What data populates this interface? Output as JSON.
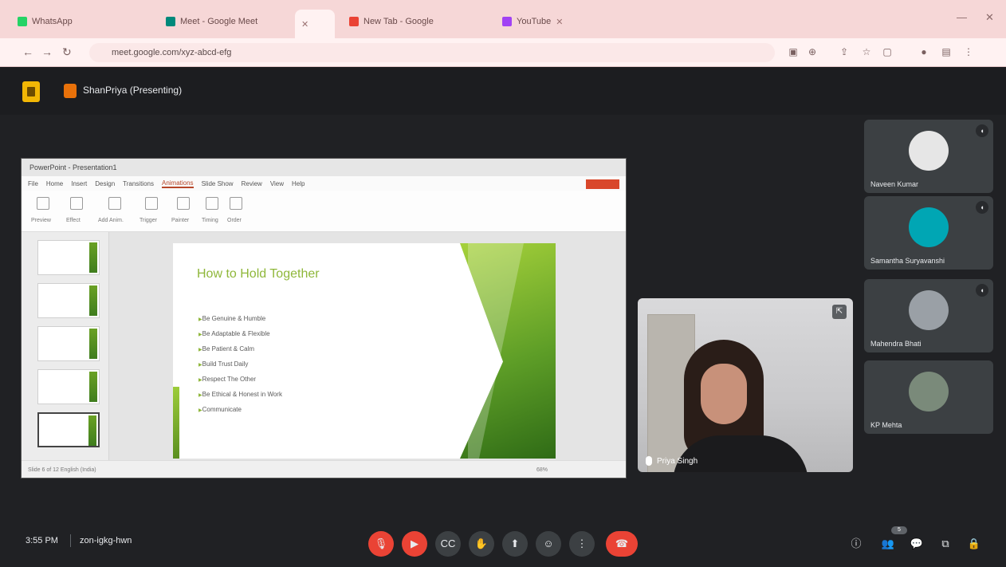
{
  "browser": {
    "tabs": [
      {
        "label": "WhatsApp",
        "color": "#25d366"
      },
      {
        "label": "Meet - Google Meet",
        "color": "#00897b"
      },
      {
        "label": "New Tab - Google",
        "color": "#ea4335"
      },
      {
        "label": "YouTube",
        "color": "#a142f4"
      }
    ],
    "url": "meet.google.com/xyz-abcd-efg"
  },
  "meet": {
    "presenter_label": "ShanPriya (Presenting)",
    "speaker_name": "Priya Singh",
    "participants": [
      {
        "name": "Naveen Kumar",
        "avatar_color": "#e6e6e6"
      },
      {
        "name": "Samantha Suryavanshi",
        "avatar_color": "#00a6b4"
      },
      {
        "name": "Mahendra Bhati",
        "avatar_color": "#9aa0a6"
      },
      {
        "name": "KP Mehta",
        "avatar_color": "#7a8a7a"
      }
    ],
    "time": "3:55 PM",
    "meeting_code": "zon-igkg-hwn"
  },
  "slide_app": {
    "title_bar": "PowerPoint - Presentation1",
    "ribbon_tabs": [
      "File",
      "Home",
      "Insert",
      "Design",
      "Transitions",
      "Animations",
      "Slide Show",
      "Review",
      "View",
      "Help"
    ],
    "active_tab": "Animations",
    "ribbon_buttons": [
      "Preview",
      "Effect",
      "Add Anim.",
      "Trigger",
      "Painter",
      "Timing",
      "Order"
    ],
    "status": "Slide 6 of 12   English (India)",
    "zoom": "68%"
  },
  "slide": {
    "title": "How to Hold Together",
    "bullets": [
      "Be Genuine & Humble",
      "Be Adaptable & Flexible",
      "Be Patient & Calm",
      "Build Trust Daily",
      "Respect The Other",
      "Be Ethical & Honest in Work",
      "Communicate"
    ]
  }
}
